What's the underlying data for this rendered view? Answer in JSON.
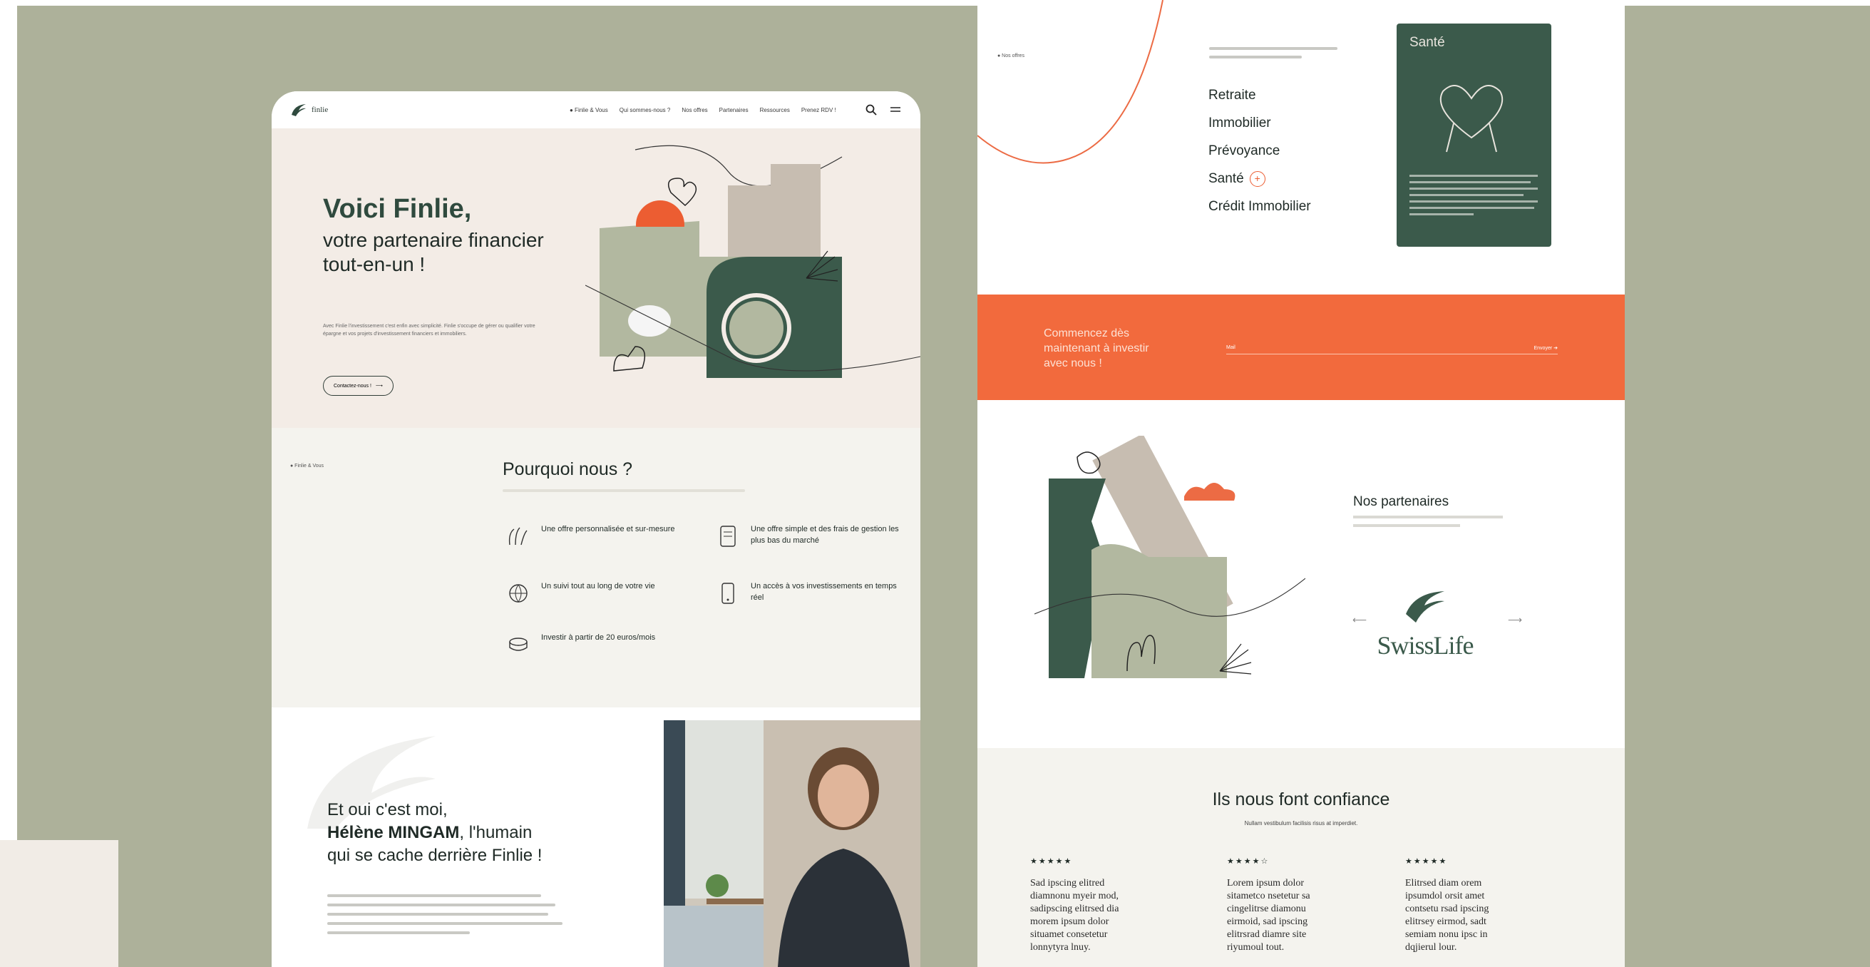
{
  "colors": {
    "background_olive": "#adb19a",
    "brand_green": "#2f4a3e",
    "accent_orange": "#f26a3d",
    "cream": "#f3ece6",
    "card_green": "#3b5a4b"
  },
  "left_page": {
    "logo_text": "finlie",
    "nav": {
      "items": [
        "● Finlie & Vous",
        "Qui sommes-nous ?",
        "Nos offres",
        "Partenaires",
        "Ressources",
        "Prenez RDV !"
      ],
      "icons": [
        "search-icon",
        "menu-icon"
      ]
    },
    "hero": {
      "title": "Voici Finlie,",
      "subtitle": "votre partenaire financier tout-en-un !",
      "body": "Avec Finlie l'investissement c'est enfin avec simplicité. Finlie s'occupe de gérer ou qualifier votre épargne et vos projets d'investissement financiers et immobiliers.",
      "cta_label": "Contactez-nous !",
      "cta_icon": "arrow-right-icon"
    },
    "why": {
      "tag": "● Finlie & Vous",
      "title": "Pourquoi nous ?",
      "features": [
        {
          "icon": "hands-icon",
          "text": "Une offre personnalisée et sur-mesure"
        },
        {
          "icon": "tablet-icon",
          "text": "Une offre simple et des frais de gestion les plus bas du marché"
        },
        {
          "icon": "globe-icon",
          "text": "Un suivi tout au long de votre vie"
        },
        {
          "icon": "phone-icon",
          "text": "Un accès à vos investissements en temps réel"
        },
        {
          "icon": "coins-icon",
          "text": "Investir à partir de 20 euros/mois"
        }
      ]
    },
    "about": {
      "line1": "Et oui c'est moi,",
      "name": "Hélène MINGAM",
      "line2_rest": ", l'humain",
      "line3": "qui se cache derrière Finlie !"
    }
  },
  "right_page": {
    "offers": {
      "tag": "● Nos offres",
      "items": [
        "Retraite",
        "Immobilier",
        "Prévoyance",
        "Santé",
        "Crédit Immobilier"
      ],
      "active_item": "Santé",
      "card_title": "Santé"
    },
    "cta": {
      "text": "Commencez dès maintenant à investir avec nous !",
      "input_placeholder": "Mail",
      "submit_label": "Envoyer ➔"
    },
    "partners": {
      "title": "Nos partenaires",
      "partner_name": "SwissLife",
      "prev_icon": "arrow-left-icon",
      "next_icon": "arrow-right-icon"
    },
    "trust": {
      "title": "Ils nous font confiance",
      "subtitle": "Nullam vestibulum facilisis risus at imperdiet.",
      "reviews": [
        {
          "stars": "★★★★★",
          "text": "Sad ipscing elitred diamnonu myeir mod, sadipscing elitrsed dia morem ipsum dolor situamet consetetur lonnytyra lnuy."
        },
        {
          "stars": "★★★★☆",
          "text": "Lorem ipsum dolor sitametco nsetetur sa cingelitrse diamonu eirmoid, sad ipscing elitrsrad diamre site riyumoul tout."
        },
        {
          "stars": "★★★★★",
          "text": "Elitrsed diam orem ipsumdol orsit amet contsetu rsad ipscing elitrsey eirmod, sadt semiam nonu ipsc in dqjierul lour."
        }
      ]
    }
  }
}
